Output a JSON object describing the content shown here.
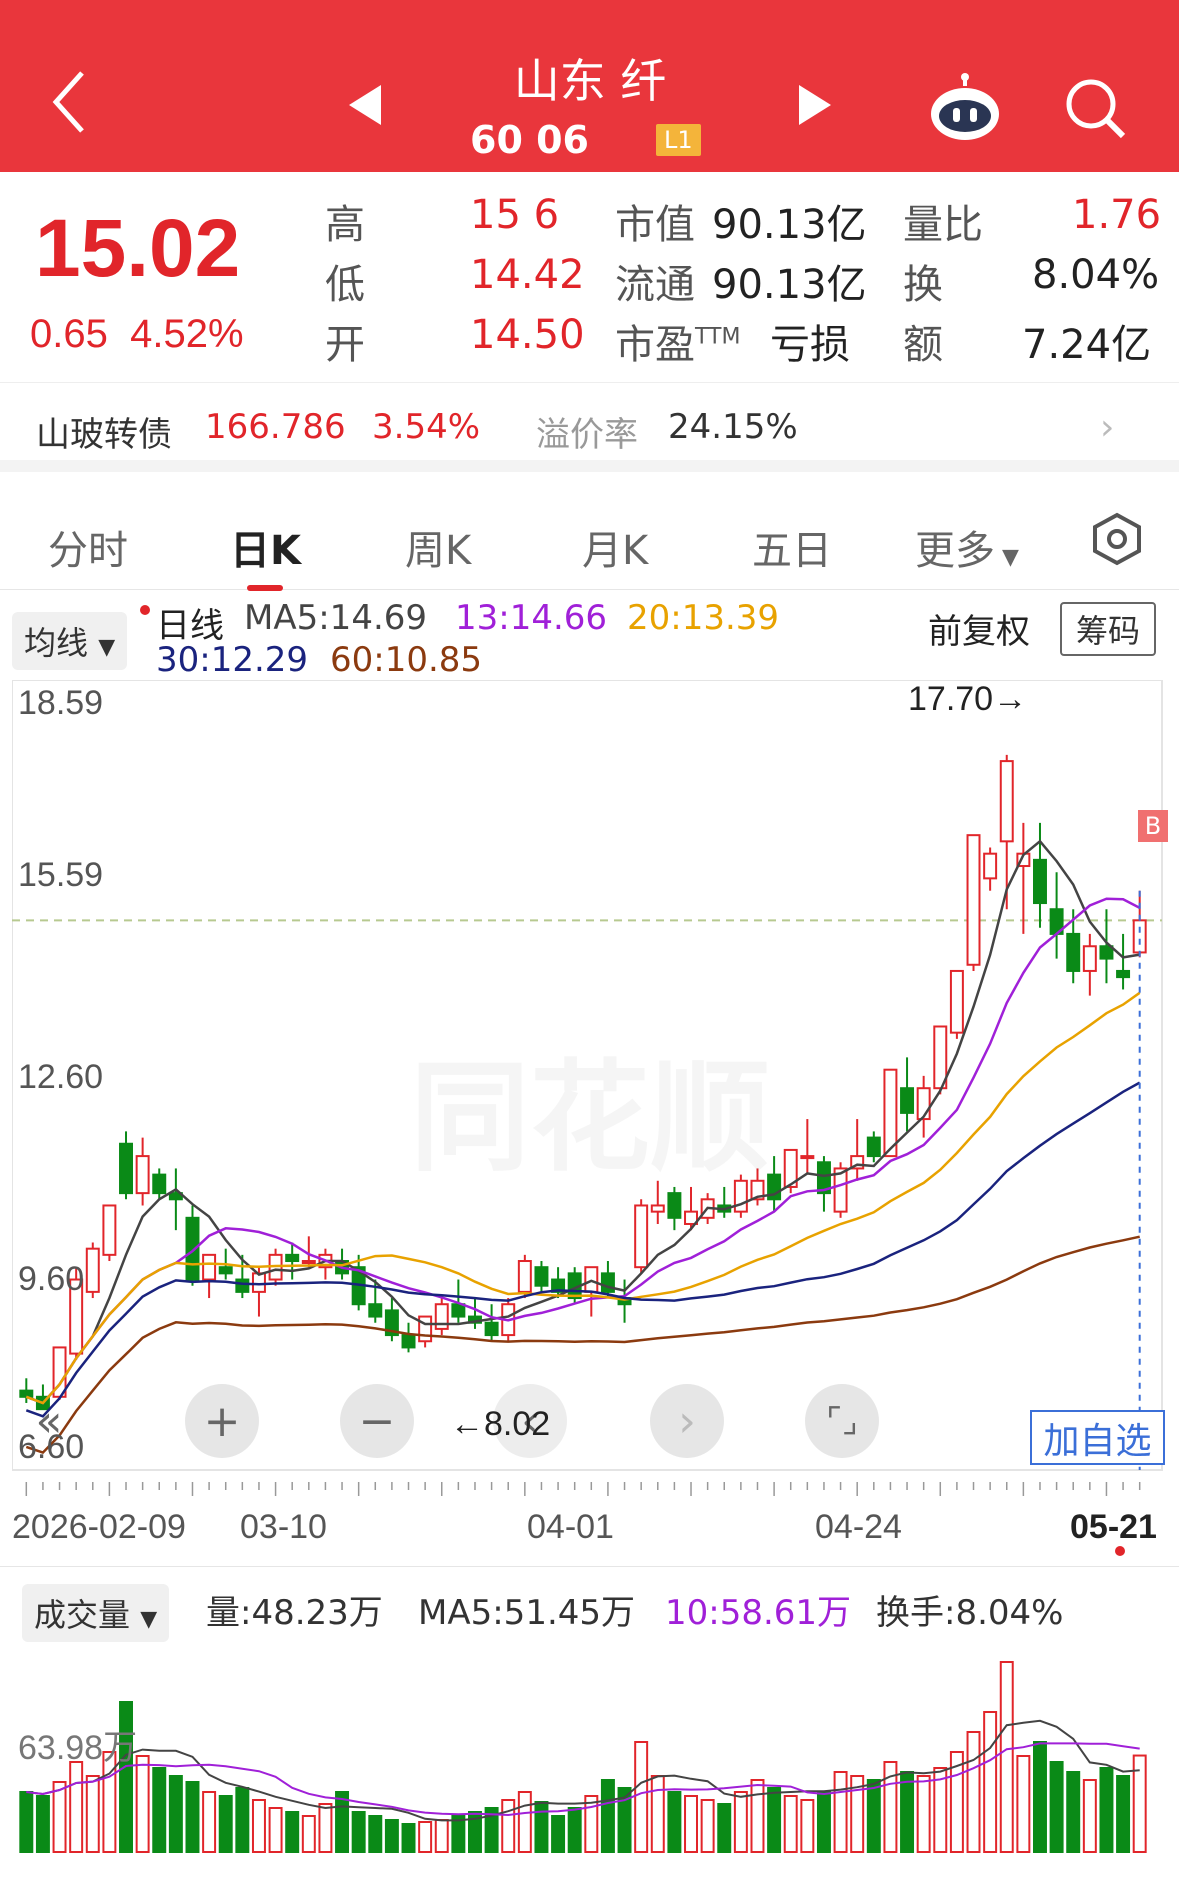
{
  "header": {
    "name": "山东 纤",
    "code": "60 06",
    "level_badge": "L1",
    "bg_color": "#e9363c"
  },
  "quote": {
    "price": "15.02",
    "change": "0.65",
    "change_pct": "4.52%",
    "high_label": "高",
    "high": "15 6",
    "low_label": "低",
    "low": "14.42",
    "open_label": "开",
    "open": "14.50",
    "mktcap_label": "市值",
    "mktcap": "90.13亿",
    "float_label": "流通",
    "float": "90.13亿",
    "pe_label": "市盈",
    "pe_sup": "TTM",
    "pe": "亏损",
    "vr_label": "量比",
    "vr": "1.76",
    "turnover_label": "换",
    "turnover": "8.04%",
    "amount_label": "额",
    "amount": "7.24亿"
  },
  "bond": {
    "name": "山玻转债",
    "price": "166.786",
    "pct": "3.54%",
    "premium_label": "溢价率",
    "premium": "24.15%"
  },
  "tabs": [
    "分时",
    "日K",
    "周K",
    "月K",
    "五日",
    "更多"
  ],
  "active_tab": "日K",
  "ma": {
    "selector": "均线",
    "prefix": "日线",
    "ma5": "MA5:14.69",
    "ma10": "13:14.66",
    "ma20": "20:13.39",
    "ma30": "30:12.29",
    "ma60": "60:10.85",
    "adjust": "前复权",
    "chips": "筹码",
    "colors": {
      "ma5": "#444444",
      "ma10": "#a020d8",
      "ma20": "#e8a200",
      "ma30": "#1a237e",
      "ma60": "#8b3a0f"
    }
  },
  "chart": {
    "y_labels": [
      "18.59",
      "15.59",
      "12.60",
      "9.60",
      "6.60"
    ],
    "max_annot": "17.70→",
    "min_annot": "←8.02",
    "b_marker": "B",
    "dates": [
      "2026-02-09",
      "03-10",
      "04-01",
      "04-24",
      "05-21"
    ],
    "add_watch": "加自选",
    "watermark": "同花顺"
  },
  "volume": {
    "selector": "成交量",
    "vol": "量:48.23万",
    "ma5": "MA5:51.45万",
    "ma10": "10:58.61万",
    "turnover": "换手:8.04%",
    "y_label": "63.98万"
  },
  "chart_data": {
    "type": "candlestick",
    "ylim": [
      6.6,
      18.59
    ],
    "candles": [
      [
        7.4,
        7.6,
        7.3,
        7.2
      ],
      [
        7.3,
        7.5,
        7.1,
        7.35
      ],
      [
        7.3,
        8.1,
        8.1,
        7.25
      ],
      [
        8.0,
        9.4,
        9.2,
        7.9
      ],
      [
        9.0,
        9.8,
        9.7,
        8.9
      ],
      [
        9.6,
        10.4,
        10.4,
        9.5
      ],
      [
        11.4,
        11.6,
        10.6,
        10.5
      ],
      [
        10.6,
        11.5,
        11.2,
        10.4
      ],
      [
        10.9,
        11.0,
        10.6,
        10.5
      ],
      [
        10.6,
        11.0,
        10.5,
        10.0
      ],
      [
        10.2,
        10.4,
        9.2,
        9.1
      ],
      [
        9.2,
        9.6,
        9.6,
        8.9
      ],
      [
        9.4,
        9.7,
        9.3,
        9.2
      ],
      [
        9.2,
        9.6,
        9.0,
        8.9
      ],
      [
        9.0,
        9.4,
        9.3,
        8.6
      ],
      [
        9.2,
        9.7,
        9.6,
        9.1
      ],
      [
        9.6,
        9.8,
        9.5,
        9.2
      ],
      [
        9.5,
        9.9,
        9.5,
        9.4
      ],
      [
        9.4,
        9.7,
        9.6,
        9.2
      ],
      [
        9.5,
        9.7,
        9.3,
        9.2
      ],
      [
        9.4,
        9.6,
        8.8,
        8.7
      ],
      [
        8.8,
        9.2,
        8.6,
        8.5
      ],
      [
        8.7,
        8.9,
        8.3,
        8.2
      ],
      [
        8.3,
        8.5,
        8.1,
        8.02
      ],
      [
        8.2,
        8.6,
        8.6,
        8.1
      ],
      [
        8.4,
        8.9,
        8.8,
        8.3
      ],
      [
        8.8,
        9.2,
        8.6,
        8.5
      ],
      [
        8.6,
        8.9,
        8.5,
        8.4
      ],
      [
        8.5,
        8.8,
        8.3,
        8.2
      ],
      [
        8.3,
        8.9,
        8.8,
        8.2
      ],
      [
        9.0,
        9.6,
        9.5,
        8.9
      ],
      [
        9.4,
        9.5,
        9.1,
        9.0
      ],
      [
        9.2,
        9.4,
        9.0,
        8.9
      ],
      [
        9.3,
        9.4,
        8.9,
        8.8
      ],
      [
        9.0,
        9.4,
        9.4,
        8.6
      ],
      [
        9.3,
        9.5,
        9.0,
        8.9
      ],
      [
        8.9,
        9.2,
        8.8,
        8.5
      ],
      [
        9.4,
        10.5,
        10.4,
        9.3
      ],
      [
        10.3,
        10.8,
        10.4,
        10.1
      ],
      [
        10.6,
        10.7,
        10.2,
        10.0
      ],
      [
        10.1,
        10.7,
        10.3,
        10.0
      ],
      [
        10.2,
        10.6,
        10.5,
        10.1
      ],
      [
        10.4,
        10.7,
        10.3,
        10.2
      ],
      [
        10.3,
        10.9,
        10.8,
        10.2
      ],
      [
        10.5,
        11.0,
        10.8,
        10.4
      ],
      [
        10.9,
        11.2,
        10.5,
        10.3
      ],
      [
        10.7,
        11.3,
        11.3,
        10.6
      ],
      [
        11.2,
        11.8,
        11.2,
        10.9
      ],
      [
        11.1,
        11.2,
        10.6,
        10.3
      ],
      [
        10.3,
        11.1,
        11.0,
        10.2
      ],
      [
        11.0,
        11.8,
        11.2,
        10.8
      ],
      [
        11.5,
        11.6,
        11.2,
        11.1
      ],
      [
        11.2,
        12.6,
        12.6,
        11.2
      ],
      [
        12.3,
        12.8,
        11.9,
        11.6
      ],
      [
        11.8,
        12.5,
        12.3,
        11.5
      ],
      [
        12.3,
        13.3,
        13.3,
        12.2
      ],
      [
        13.2,
        14.0,
        14.2,
        13.1
      ],
      [
        14.3,
        16.2,
        16.4,
        14.2
      ],
      [
        15.7,
        16.2,
        16.1,
        15.5
      ],
      [
        16.3,
        17.7,
        17.6,
        15.2
      ],
      [
        15.9,
        16.6,
        16.1,
        14.8
      ],
      [
        16.0,
        16.6,
        15.3,
        14.9
      ],
      [
        15.2,
        15.8,
        14.8,
        14.4
      ],
      [
        14.8,
        15.2,
        14.2,
        14.0
      ],
      [
        14.2,
        14.8,
        14.6,
        13.8
      ],
      [
        14.6,
        15.2,
        14.4,
        14.0
      ],
      [
        14.2,
        14.8,
        14.1,
        13.9
      ],
      [
        14.5,
        15.5,
        15.02,
        14.42
      ]
    ],
    "volumes": [
      30,
      28,
      35,
      45,
      38,
      50,
      75,
      48,
      42,
      38,
      35,
      30,
      28,
      32,
      26,
      22,
      20,
      18,
      24,
      30,
      20,
      18,
      16,
      14,
      15,
      16,
      18,
      20,
      22,
      26,
      30,
      25,
      18,
      22,
      28,
      36,
      32,
      55,
      38,
      30,
      28,
      26,
      24,
      30,
      36,
      32,
      28,
      26,
      30,
      40,
      38,
      36,
      45,
      40,
      38,
      42,
      50,
      60,
      70,
      95,
      48,
      55,
      45,
      40,
      36,
      42,
      38,
      48.23
    ]
  }
}
